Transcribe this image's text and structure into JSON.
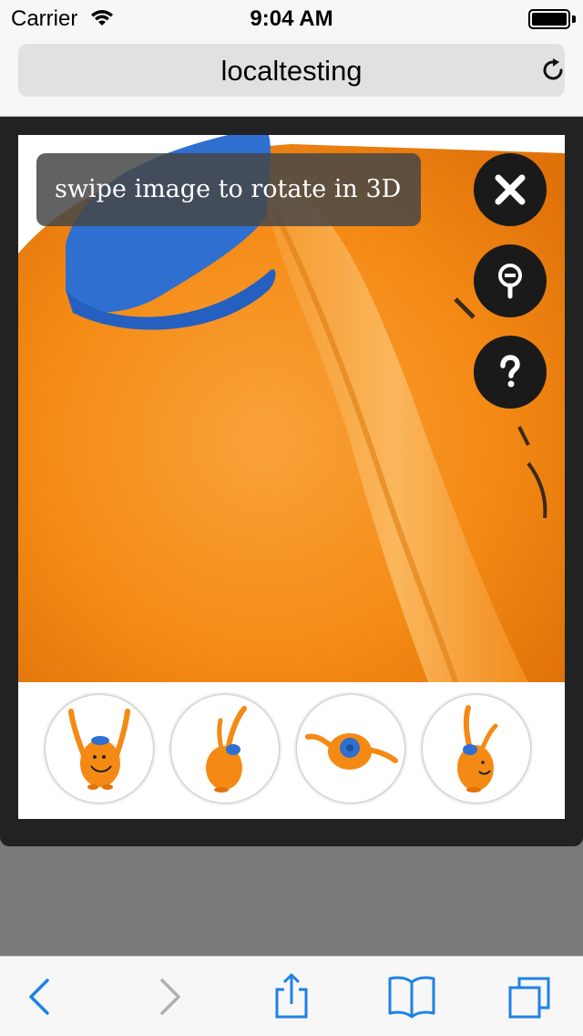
{
  "status_bar": {
    "carrier": "Carrier",
    "time": "9:04 AM"
  },
  "browser": {
    "url_text": "localtesting"
  },
  "viewer": {
    "hint_text": "swipe image to rotate in 3D",
    "buttons": [
      "close-icon",
      "zoom-out-icon",
      "help-icon"
    ],
    "thumbnail_count": 4
  },
  "toolbar": {
    "icons": [
      "back-icon",
      "forward-icon",
      "share-icon",
      "bookmarks-icon",
      "tabs-icon"
    ]
  },
  "colors": {
    "accent": "#1e82e6",
    "plush_orange": "#f7941d",
    "hat_blue": "#2f6fd0",
    "overlay": "#222222"
  }
}
